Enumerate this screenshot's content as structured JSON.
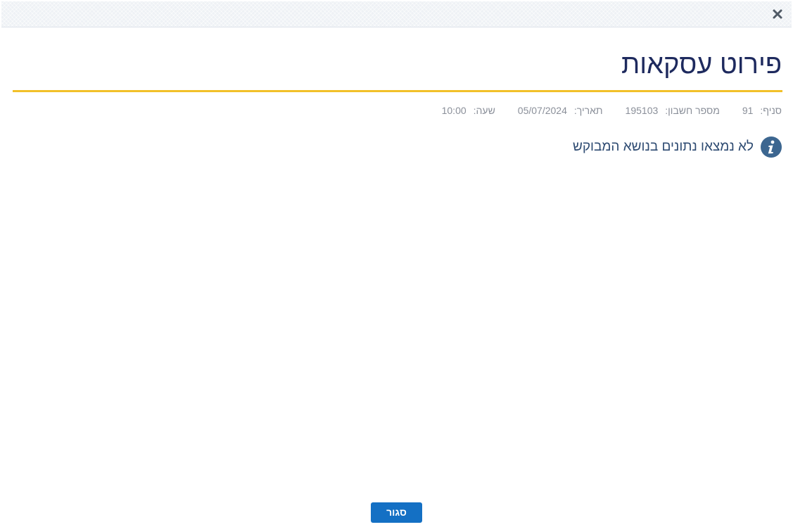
{
  "header": {
    "close_icon": "close-x-icon"
  },
  "page": {
    "title": "פירוט עסקאות"
  },
  "meta": {
    "branch_label": "סניף:",
    "branch_value": "91",
    "account_label": "מספר חשבון:",
    "account_value": "195103",
    "date_label": "תאריך:",
    "date_value": "05/07/2024",
    "time_label": "שעה:",
    "time_value": "10:00"
  },
  "info": {
    "icon": "info-icon",
    "message": "לא נמצאו נתונים בנושא המבוקש"
  },
  "footer": {
    "close_label": "סגור"
  },
  "colors": {
    "title": "#1e2a5e",
    "accent_divider": "#f2c029",
    "button": "#1470c4",
    "info_icon": "#3c6690",
    "info_text": "#2e4b72",
    "meta_text": "#8a8f99"
  }
}
